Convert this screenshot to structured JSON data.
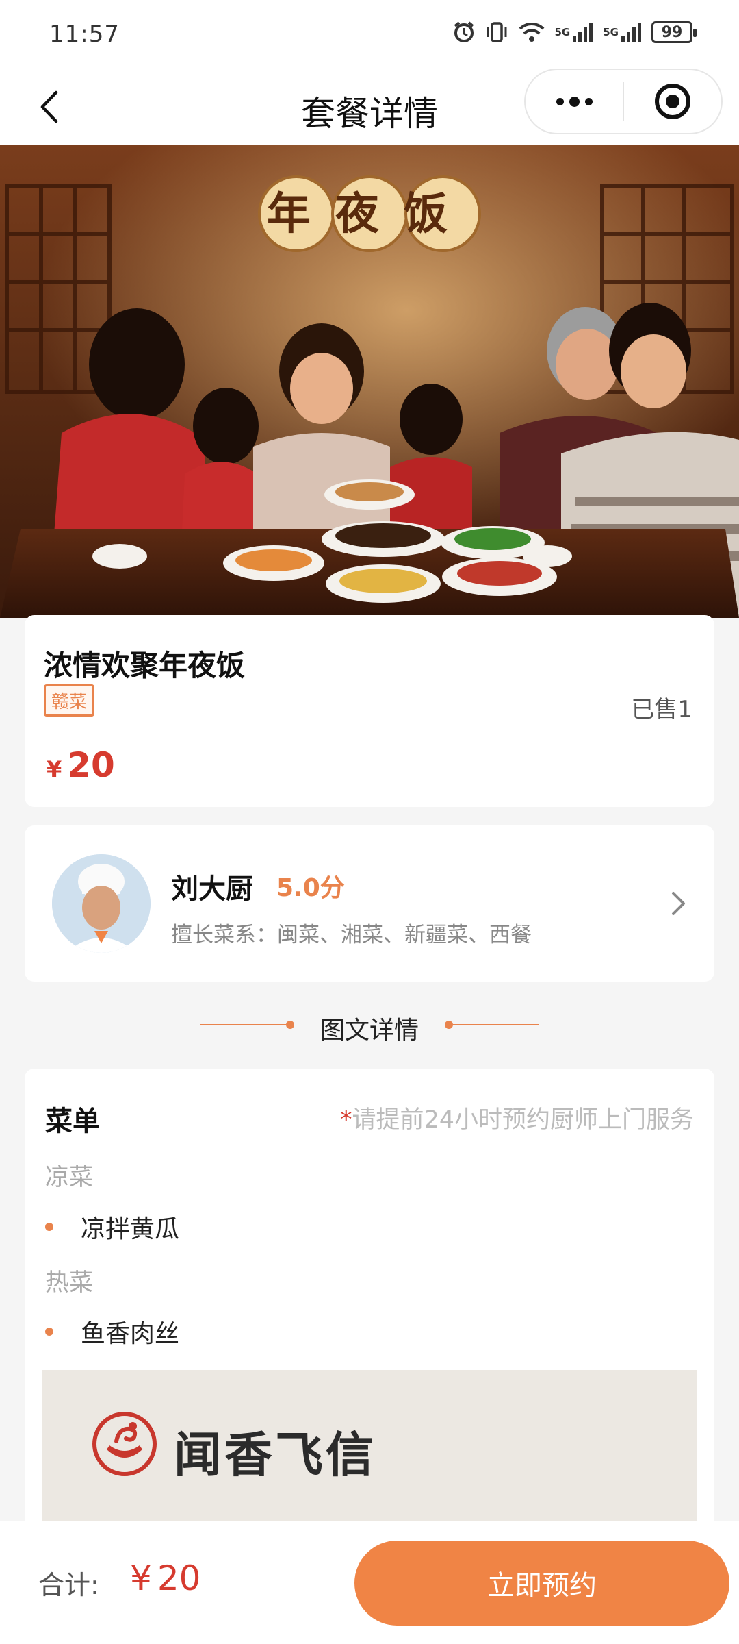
{
  "status_bar": {
    "time": "11:57",
    "signal_1": "5G",
    "signal_2": "5G",
    "battery": "99"
  },
  "nav": {
    "title": "套餐详情",
    "back_icon": "chevron-left-icon",
    "more_icon": "more-dots-icon",
    "close_icon": "target-circle-icon"
  },
  "hero": {
    "badge_text": "年夜饭"
  },
  "product": {
    "name": "浓情欢聚年夜饭",
    "tag": "赣菜",
    "sold": "已售1",
    "price_symbol": "¥",
    "price": "20"
  },
  "chef": {
    "name": "刘大厨",
    "score": "5.0分",
    "cuisine": "擅长菜系：闽菜、湘菜、新疆菜、西餐"
  },
  "detail_section": {
    "title": "图文详情"
  },
  "menu": {
    "title": "菜单",
    "note_star": "*",
    "note": "请提前24小时预约厨师上门服务",
    "categories": [
      {
        "name": "凉菜",
        "dishes": [
          "凉拌黄瓜"
        ]
      },
      {
        "name": "热菜",
        "dishes": [
          "鱼香肉丝"
        ]
      }
    ],
    "brand": "闻香飞信"
  },
  "bottom": {
    "total_label": "合计:",
    "total_symbol": "¥",
    "total_value": "20",
    "book_label": "立即预约"
  },
  "colors": {
    "accent": "#f08445",
    "price": "#d63b2f",
    "tag": "#e9834c"
  }
}
